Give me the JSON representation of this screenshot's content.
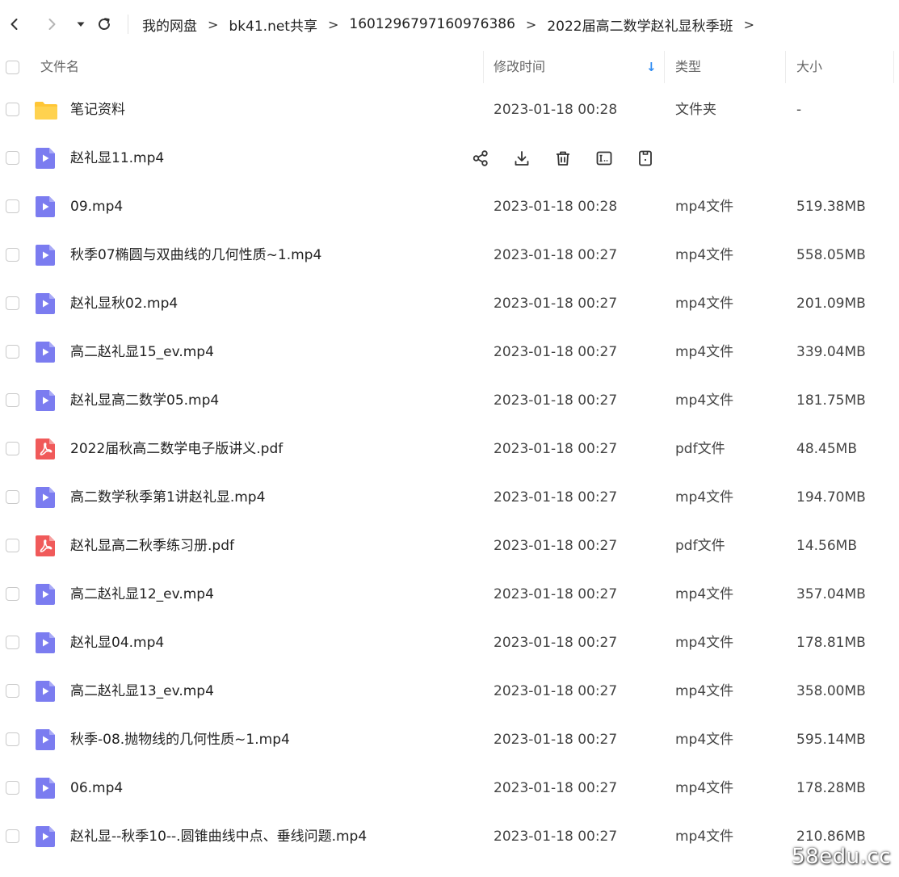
{
  "breadcrumb": [
    "我的网盘",
    "bk41.net共享",
    "1601296797160976386",
    "2022届高二数学赵礼显秋季班"
  ],
  "breadcrumb_separator": ">",
  "header": {
    "name": "文件名",
    "modified": "修改时间",
    "type": "类型",
    "size": "大小"
  },
  "sort_indicator": "↓",
  "files": [
    {
      "name": "笔记资料",
      "time": "2023-01-18 00:28",
      "type": "文件夹",
      "size": "-",
      "icon": "folder-icon"
    },
    {
      "name": "赵礼显11.mp4",
      "time": "",
      "type": "",
      "size": "",
      "icon": "video-file-icon",
      "hovered": true
    },
    {
      "name": "09.mp4",
      "time": "2023-01-18 00:28",
      "type": "mp4文件",
      "size": "519.38MB",
      "icon": "video-file-icon"
    },
    {
      "name": "秋季07椭圆与双曲线的几何性质~1.mp4",
      "time": "2023-01-18 00:27",
      "type": "mp4文件",
      "size": "558.05MB",
      "icon": "video-file-icon"
    },
    {
      "name": "赵礼显秋02.mp4",
      "time": "2023-01-18 00:27",
      "type": "mp4文件",
      "size": "201.09MB",
      "icon": "video-file-icon"
    },
    {
      "name": "高二赵礼显15_ev.mp4",
      "time": "2023-01-18 00:27",
      "type": "mp4文件",
      "size": "339.04MB",
      "icon": "video-file-icon"
    },
    {
      "name": "赵礼显高二数学05.mp4",
      "time": "2023-01-18 00:27",
      "type": "mp4文件",
      "size": "181.75MB",
      "icon": "video-file-icon"
    },
    {
      "name": "2022届秋高二数学电子版讲义.pdf",
      "time": "2023-01-18 00:27",
      "type": "pdf文件",
      "size": "48.45MB",
      "icon": "pdf-file-icon"
    },
    {
      "name": "高二数学秋季第1讲赵礼显.mp4",
      "time": "2023-01-18 00:27",
      "type": "mp4文件",
      "size": "194.70MB",
      "icon": "video-file-icon"
    },
    {
      "name": "赵礼显高二秋季练习册.pdf",
      "time": "2023-01-18 00:27",
      "type": "pdf文件",
      "size": "14.56MB",
      "icon": "pdf-file-icon"
    },
    {
      "name": "高二赵礼显12_ev.mp4",
      "time": "2023-01-18 00:27",
      "type": "mp4文件",
      "size": "357.04MB",
      "icon": "video-file-icon"
    },
    {
      "name": "赵礼显04.mp4",
      "time": "2023-01-18 00:27",
      "type": "mp4文件",
      "size": "178.81MB",
      "icon": "video-file-icon"
    },
    {
      "name": "高二赵礼显13_ev.mp4",
      "time": "2023-01-18 00:27",
      "type": "mp4文件",
      "size": "358.00MB",
      "icon": "video-file-icon"
    },
    {
      "name": "秋季-08.抛物线的几何性质~1.mp4",
      "time": "2023-01-18 00:27",
      "type": "mp4文件",
      "size": "595.14MB",
      "icon": "video-file-icon"
    },
    {
      "name": "06.mp4",
      "time": "2023-01-18 00:27",
      "type": "mp4文件",
      "size": "178.28MB",
      "icon": "video-file-icon"
    },
    {
      "name": "赵礼显--秋季10--.圆锥曲线中点、垂线问题.mp4",
      "time": "2023-01-18 00:27",
      "type": "mp4文件",
      "size": "210.86MB",
      "icon": "video-file-icon"
    }
  ],
  "row_actions": [
    "share-icon",
    "download-icon",
    "delete-icon",
    "rename-icon",
    "more-icon"
  ],
  "watermark": "58edu.cc",
  "colors": {
    "video_icon": "#7b7cf0",
    "pdf_icon": "#f05a5a",
    "folder_icon": "#ffc636",
    "sort_arrow": "#2f8bf2"
  }
}
